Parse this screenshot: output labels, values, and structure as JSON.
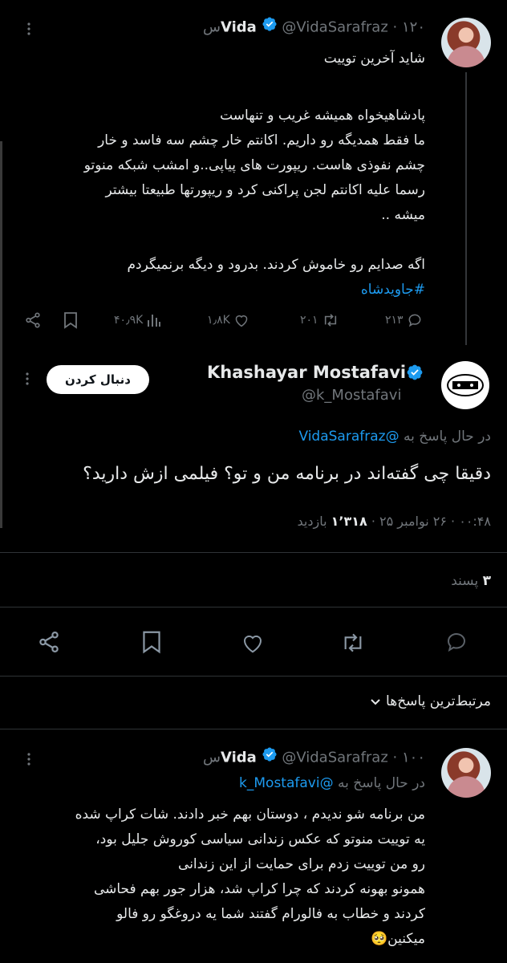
{
  "tweet1": {
    "name": "Vida",
    "handle": "@VidaSarafraz",
    "time": "۱۲۰س",
    "lines": [
      "شاید آخرین توییت",
      "",
      "پادشاهیخواه همیشه غریب و تنهاست",
      "ما فقط همدیگه رو داریم. اکانتم خار چشم سه فاسد و خار",
      "چشم نفوذی هاست. ریپورت های پیاپی..و امشب شبکه منوتو",
      "رسما علیه اکانتم لجن پراکنی کرد و ریپورتها طبیعتا بیشتر",
      "میشه ..",
      "",
      "اگه صدایم رو خاموش کردند. بدرود و دیگه برنمیگردم"
    ],
    "hashtag": "#جاویدشاه",
    "stats": {
      "replies": "۲۱۳",
      "retweets": "۲۰۱",
      "likes": "۱٫۸K",
      "views": "۴۰٫۹K"
    }
  },
  "main_tweet": {
    "name": "Khashayar Mostafavi",
    "handle": "@k_Mostafavi",
    "follow_label": "دنبال کردن",
    "reply_prefix": "در حال پاسخ به",
    "reply_to": "@VidaSarafraz",
    "text": "دقیقا چی گفته‌اند در برنامه من و تو؟ فیلمی ازش دارید؟",
    "meta_time": "۰۰:۴۸ · ۲۶ نوامبر ۲۵",
    "meta_views_count": "۱٬۳۱۸",
    "meta_views_label": "بازدید",
    "likes_count": "۳",
    "likes_label": "پسند"
  },
  "sort": {
    "label": "مرتبط‌ترین پاسخ‌ها"
  },
  "reply": {
    "name": "Vida",
    "handle": "@VidaSarafraz",
    "time": "۱۰۰س",
    "reply_prefix": "در حال پاسخ به",
    "reply_to": "@k_Mostafavi",
    "lines": [
      "من برنامه شو ندیدم ، دوستان بهم خبر دادند. شات کراپ شده",
      "یه توییت منوتو که عکس زندانی سیاسی کوروش جلیل بود،",
      "رو من توییت زدم برای حمایت از این زندانی",
      "همونو بهونه کردند که چرا کراپ شد، هزار جور بهم فحاشی",
      "کردند و خطاب به فالورام گفتند شما یه دروغگو رو فالو",
      "میکنین🥺"
    ]
  },
  "colors": {
    "background": "#000000",
    "text": "#e7e9ea",
    "muted": "#71767b",
    "accent": "#1d9bf0",
    "divider": "#2f3336"
  },
  "icons": [
    "more-icon",
    "verified-icon",
    "reply-icon",
    "retweet-icon",
    "like-icon",
    "views-icon",
    "bookmark-icon",
    "share-icon",
    "chevron-down-icon",
    "sort-icon"
  ]
}
